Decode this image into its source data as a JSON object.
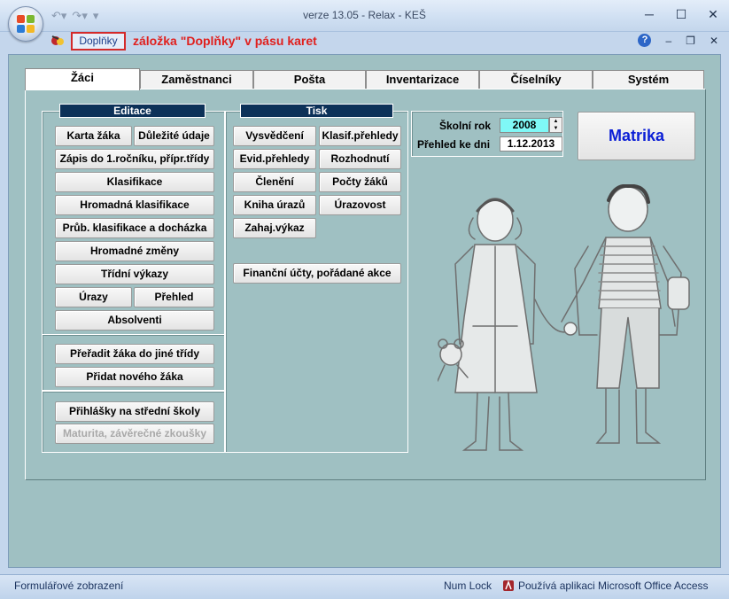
{
  "window": {
    "title": "verze 13.05 - Relax - KEŠ",
    "minimize": "─",
    "maximize": "☐",
    "close": "✕"
  },
  "ribbon": {
    "tab_label": "Doplňky",
    "annotation": "záložka \"Doplňky\" v pásu karet",
    "help": "?",
    "min": "–",
    "restore": "❐",
    "close": "✕"
  },
  "tabs": [
    "Žáci",
    "Zaměstnanci",
    "Pošta",
    "Inventarizace",
    "Číselníky",
    "Systém"
  ],
  "editace": {
    "header": "Editace",
    "karta_zaka": "Karta žáka",
    "dulezite_udaje": "Důležité údaje",
    "zapis": "Zápis do 1.ročníku, přípr.třídy",
    "klasifikace": "Klasifikace",
    "hromadna_klasifikace": "Hromadná klasifikace",
    "prubezna": "Průb. klasifikace a docházka",
    "hromadne_zmeny": "Hromadné změny",
    "tridni_vykazy": "Třídní výkazy",
    "urazy": "Úrazy",
    "prehled": "Přehled",
    "absolventi": "Absolventi",
    "preradit": "Přeřadit žáka do jiné třídy",
    "pridat": "Přidat nového žáka",
    "prihlasky": "Přihlášky na střední školy",
    "maturita": "Maturita, závěrečné zkoušky"
  },
  "tisk": {
    "header": "Tisk",
    "vysvedceni": "Vysvědčení",
    "klasif_prehledy": "Klasif.přehledy",
    "evid_prehledy": "Evid.přehledy",
    "rozhodnuti": "Rozhodnutí",
    "cleneni": "Členění",
    "pocty_zaku": "Počty žáků",
    "kniha_urazu": "Kniha úrazů",
    "urazovost": "Úrazovost",
    "zahaj_vykaz": "Zahaj.výkaz",
    "financni_ucty": "Finanční účty, pořádané akce"
  },
  "info": {
    "skolni_rok_label": "Školní rok",
    "skolni_rok_value": "2008",
    "prehled_label": "Přehled ke dni",
    "prehled_value": "1.12.2013"
  },
  "matrika_button": "Matrika",
  "statusbar": {
    "left": "Formulářové zobrazení",
    "num_lock": "Num Lock",
    "access": "Používá aplikaci Microsoft Office Access"
  },
  "colors": {
    "client_bg": "#9fc0c2",
    "section_header": "#0c3158",
    "annotation_red": "#e0201e",
    "matrika_text": "#0b1fd6",
    "year_field": "#7ff8f6"
  }
}
